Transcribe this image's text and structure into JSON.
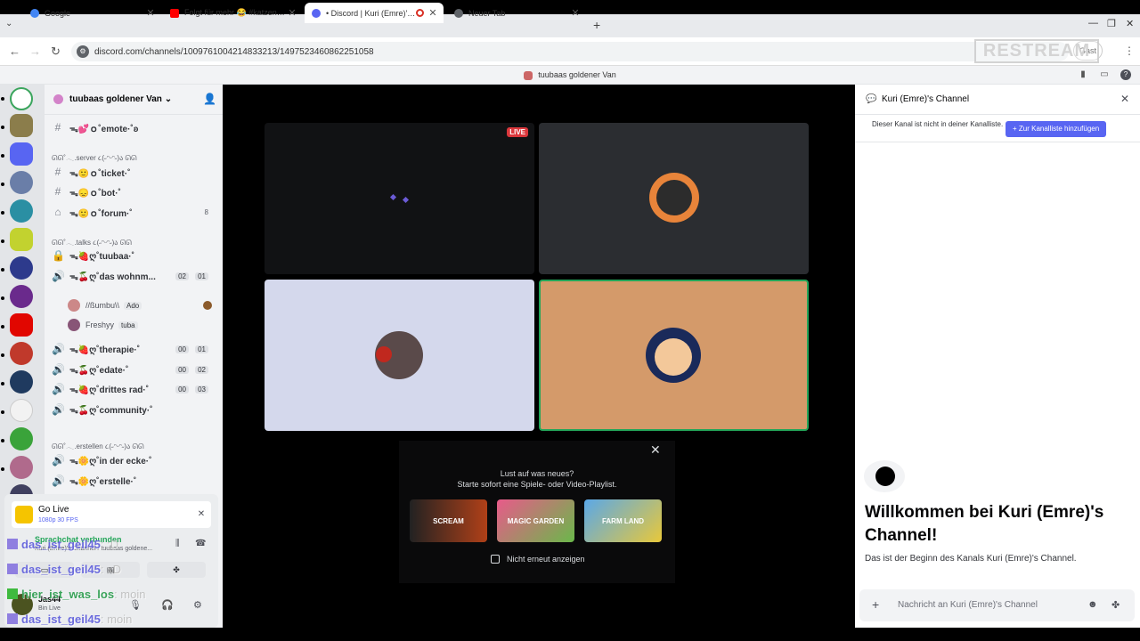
{
  "browser": {
    "tabs": [
      {
        "title": "Google",
        "color": "#4285f4"
      },
      {
        "title": "Folgt für mehr 😂 #katzenvideos",
        "color": "#ff0000"
      },
      {
        "title": "• Discord | Kuri (Emre)'s Channel",
        "color": "#5865f2"
      },
      {
        "title": "Neuer Tab",
        "color": "#5f6368"
      }
    ],
    "new_tab": "+",
    "url": "discord.com/channels/1009761004214833213/1497523460862251058",
    "guest_label": "Gast",
    "overlay_logo": "RESTREAM"
  },
  "discord": {
    "window_title": "tuubaas goldener Van",
    "server_name": "tuubaas goldener Van",
    "channels": [
      {
        "type": "text",
        "name": "ᯓ💕ｏ˚emote·˚ʚ"
      },
      {
        "type": "category",
        "name": "ᘏᘏ˚𓂃.server ૮(˶ᵔᵕᵔ˶)ა ᘏᘏ"
      },
      {
        "type": "text",
        "name": "ᯓ🙂ｏ˚ticket·˚"
      },
      {
        "type": "text",
        "name": "ᯓ😞ｏ˚bot·˚"
      },
      {
        "type": "forum",
        "name": "ᯓ🙂ｏ˚forum·˚",
        "count": "8"
      },
      {
        "type": "category",
        "name": "ᘏᘏ˚𓂃.talks ૮(˶ᵔᵕᵔ˶)ა ᘏᘏ"
      },
      {
        "type": "locked",
        "name": "ᯓ🍓ღ˚tuubaa·˚"
      },
      {
        "type": "voice",
        "name": "ᯓ🍒ღ˚das wohnm...",
        "users": "02",
        "limit": "01"
      },
      {
        "type": "voice",
        "name": "ᯓ🍓ღ˚therapie·˚",
        "users": "00",
        "limit": "01"
      },
      {
        "type": "voice",
        "name": "ᯓ🍒ღ˚edate·˚",
        "users": "00",
        "limit": "02"
      },
      {
        "type": "voice",
        "name": "ᯓ🍓ღ˚drittes rad·˚",
        "users": "00",
        "limit": "03"
      },
      {
        "type": "voice",
        "name": "ᯓ🍒ღ˚community·˚"
      },
      {
        "type": "category",
        "name": "ᘏᘏ˚𓂃.erstellen ૮(˶ᵔᵕᵔ˶)ა ᘏᘏ"
      },
      {
        "type": "voice",
        "name": "ᯓ🌼ღ˚in der ecke·˚"
      },
      {
        "type": "voice",
        "name": "ᯓ🌼ღ˚erstelle·˚"
      }
    ],
    "voice_users": [
      {
        "name": "//ßumbu\\\\",
        "tag": "Ado"
      },
      {
        "name": "Freshyy",
        "tag": "tuba"
      }
    ],
    "go_live": {
      "title": "Go Live",
      "quality": "1080p 30 FPS"
    },
    "voice_status": {
      "label": "Sprachchat verbunden",
      "sub": "Kuri (Emre)'s Channel / tuubaas goldene..."
    },
    "user": {
      "name": "Jas44",
      "status": "Bin Live"
    },
    "chat_overlay": [
      {
        "user": "das_ist_geil45",
        "msg": ":D",
        "platform": "twitch"
      },
      {
        "user": "das_ist_geil45",
        "msg": "xD",
        "platform": "twitch"
      },
      {
        "user": "hier_ist_was_los",
        "msg": "moin",
        "platform": "kick"
      },
      {
        "user": "das_ist_geil45",
        "msg": "moin",
        "platform": "twitch"
      }
    ],
    "stage": {
      "live_badge": "LIVE",
      "promo_line1": "Lust auf was neues?",
      "promo_line2": "Starte sofort eine Spiele- oder Video-Playlist.",
      "promo_cards": [
        "SCREAM",
        "MAGIC GARDEN",
        "FARM LAND"
      ],
      "promo_checkbox": "Nicht erneut anzeigen"
    },
    "chat_panel": {
      "title": "Kuri (Emre)'s Channel",
      "notice": "Dieser Kanal ist nicht in deiner Kanalliste.",
      "add_button": "+ Zur Kanalliste hinzufügen",
      "welcome": "Willkommen bei Kuri (Emre)'s Channel!",
      "welcome_sub": "Das ist der Beginn des Kanals Kuri (Emre)'s Channel.",
      "input_placeholder": "Nachricht an Kuri (Emre)'s Channel"
    }
  }
}
